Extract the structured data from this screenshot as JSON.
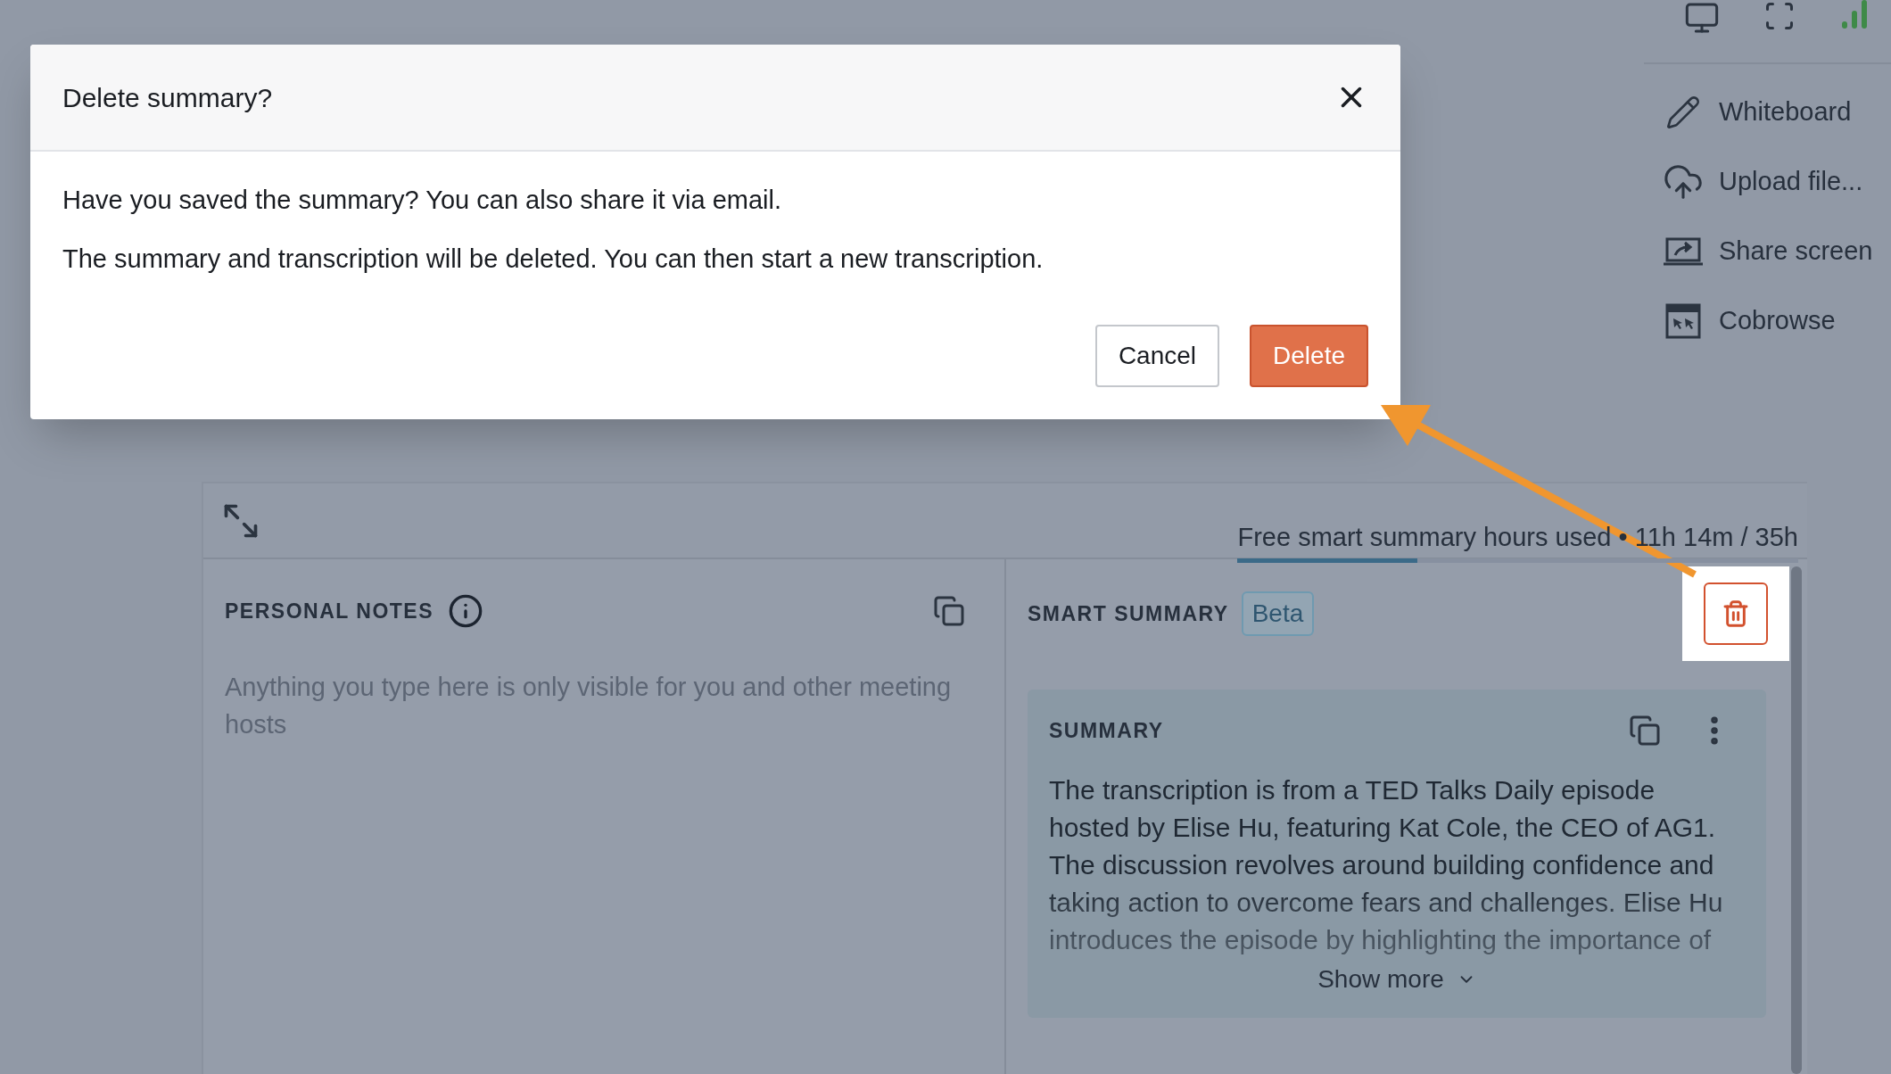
{
  "dialog": {
    "title": "Delete summary?",
    "paragraphs": [
      "Have you saved the summary? You can also share it via email.",
      "The summary and transcription will be deleted. You can then start a new transcription."
    ],
    "buttons": [
      {
        "label": "Cancel",
        "kind": "secondary"
      },
      {
        "label": "Delete",
        "kind": "danger"
      }
    ]
  },
  "sidebar": {
    "items": [
      {
        "label": "Whiteboard",
        "kind": "pencil"
      },
      {
        "label": "Upload file...",
        "kind": "upload"
      },
      {
        "label": "Share screen",
        "kind": "share"
      },
      {
        "label": "Cobrowse",
        "kind": "cobrowse"
      }
    ]
  },
  "usage": {
    "label": "Free smart summary hours used • 11h 14m / 35h",
    "level": 0.32
  },
  "personal_notes": {
    "title": "PERSONAL NOTES",
    "placeholder": "Anything you type here is only visible for you and other meeting hosts"
  },
  "smart_summary": {
    "title": "SMART SUMMARY",
    "badge": "Beta",
    "delete_highlighted": true,
    "summary": {
      "title": "SUMMARY",
      "text": "The transcription is from a TED Talks Daily episode hosted by Elise Hu, featuring Kat Cole, the CEO of AG1. The discussion revolves around building confidence and taking action to overcome fears and challenges. Elise Hu introduces the episode by highlighting the importance of",
      "show_more": "Show more"
    }
  }
}
